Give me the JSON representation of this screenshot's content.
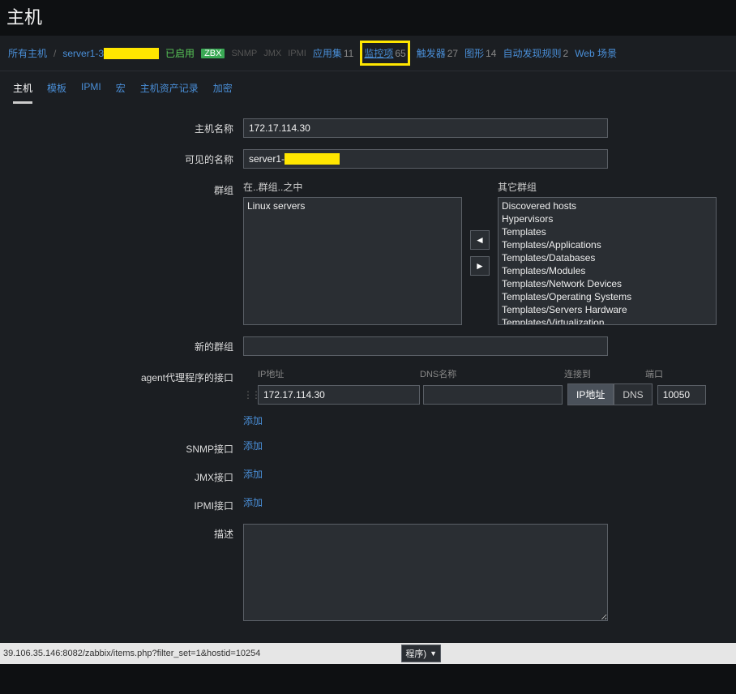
{
  "page_title": "主机",
  "breadcrumb": {
    "all_hosts": "所有主机",
    "host_name_prefix": "server1-3",
    "enabled": "已启用",
    "zbx": "ZBX",
    "protocols": [
      "SNMP",
      "JMX",
      "IPMI"
    ],
    "links": [
      {
        "label": "应用集",
        "count": "11"
      },
      {
        "label": "监控项",
        "count": "65",
        "highlight": true
      },
      {
        "label": "触发器",
        "count": "27"
      },
      {
        "label": "图形",
        "count": "14"
      },
      {
        "label": "自动发现规则",
        "count": "2"
      },
      {
        "label": "Web 场景",
        "count": ""
      }
    ]
  },
  "tabs": [
    "主机",
    "模板",
    "IPMI",
    "宏",
    "主机资产记录",
    "加密"
  ],
  "active_tab": 0,
  "form": {
    "host_name_label": "主机名称",
    "host_name_value": "172.17.114.30",
    "visible_name_label": "可见的名称",
    "visible_name_prefix": "server1-",
    "groups_label": "群组",
    "in_groups_label": "在..群组..之中",
    "other_groups_label": "其它群组",
    "in_groups": [
      "Linux servers"
    ],
    "other_groups": [
      "Discovered hosts",
      "Hypervisors",
      "Templates",
      "Templates/Applications",
      "Templates/Databases",
      "Templates/Modules",
      "Templates/Network Devices",
      "Templates/Operating Systems",
      "Templates/Servers Hardware",
      "Templates/Virtualization"
    ],
    "new_group_label": "新的群组",
    "new_group_value": "",
    "agent_iface_label": "agent代理程序的接口",
    "iface_headers": {
      "ip": "IP地址",
      "dns": "DNS名称",
      "connect": "连接到",
      "port": "端口"
    },
    "agent_iface": {
      "ip": "172.17.114.30",
      "dns": "",
      "connect_ip": "IP地址",
      "connect_dns": "DNS",
      "port": "10050"
    },
    "add_label": "添加",
    "snmp_label": "SNMP接口",
    "jmx_label": "JMX接口",
    "ipmi_label": "IPMI接口",
    "desc_label": "描述",
    "desc_value": ""
  },
  "monitored_by_suffix": "程序)",
  "status_url": "39.106.35.146:8082/zabbix/items.php?filter_set=1&hostid=10254"
}
